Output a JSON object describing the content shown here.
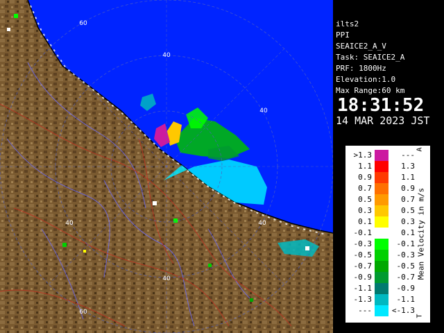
{
  "radar": {
    "range_rings": [
      {
        "label": "60"
      },
      {
        "label": "40"
      },
      {
        "label": "40"
      },
      {
        "label": "40"
      },
      {
        "label": "40"
      },
      {
        "label": "40"
      },
      {
        "label": "60"
      }
    ]
  },
  "info": {
    "site": "ilts2",
    "product": "PPI",
    "scan": "SEAICE2_A_V",
    "task": "Task: SEAICE2_A",
    "prf": "PRF: 1800Hz",
    "elevation": "Elevation:1.0",
    "max_range": "Max Range:60 km",
    "time": "18:31:52",
    "date": "14 MAR 2023 JST"
  },
  "legend": {
    "title": "Mean Velocity in m/s",
    "unit_marker_top": "A",
    "unit_marker_bottom": "T",
    "rows": [
      {
        "lo": ">1.3",
        "hi": "---",
        "color": "#cc1aa0"
      },
      {
        "lo": "1.1",
        "hi": "1.3",
        "color": "#ff0000"
      },
      {
        "lo": "0.9",
        "hi": "1.1",
        "color": "#ff3a00"
      },
      {
        "lo": "0.7",
        "hi": "0.9",
        "color": "#ff7000"
      },
      {
        "lo": "0.5",
        "hi": "0.7",
        "color": "#ff9a00"
      },
      {
        "lo": "0.3",
        "hi": "0.5",
        "color": "#ffc800"
      },
      {
        "lo": "0.1",
        "hi": "0.3",
        "color": "#ffff00"
      },
      {
        "lo": "-0.1",
        "hi": "0.1",
        "color": "#ffffff"
      },
      {
        "lo": "-0.3",
        "hi": "-0.1",
        "color": "#00ff00"
      },
      {
        "lo": "-0.5",
        "hi": "-0.3",
        "color": "#00d000"
      },
      {
        "lo": "-0.7",
        "hi": "-0.5",
        "color": "#00a800"
      },
      {
        "lo": "-0.9",
        "hi": "-0.7",
        "color": "#009a30"
      },
      {
        "lo": "-1.1",
        "hi": "-0.9",
        "color": "#007a70"
      },
      {
        "lo": "-1.3",
        "hi": "-1.1",
        "color": "#00b8c0"
      },
      {
        "lo": "---",
        "hi": "<-1.3",
        "color": "#00e8ff"
      }
    ]
  },
  "colors": {
    "sea": "#0024ff",
    "land": "#7a5a30",
    "coast": "#000000"
  }
}
